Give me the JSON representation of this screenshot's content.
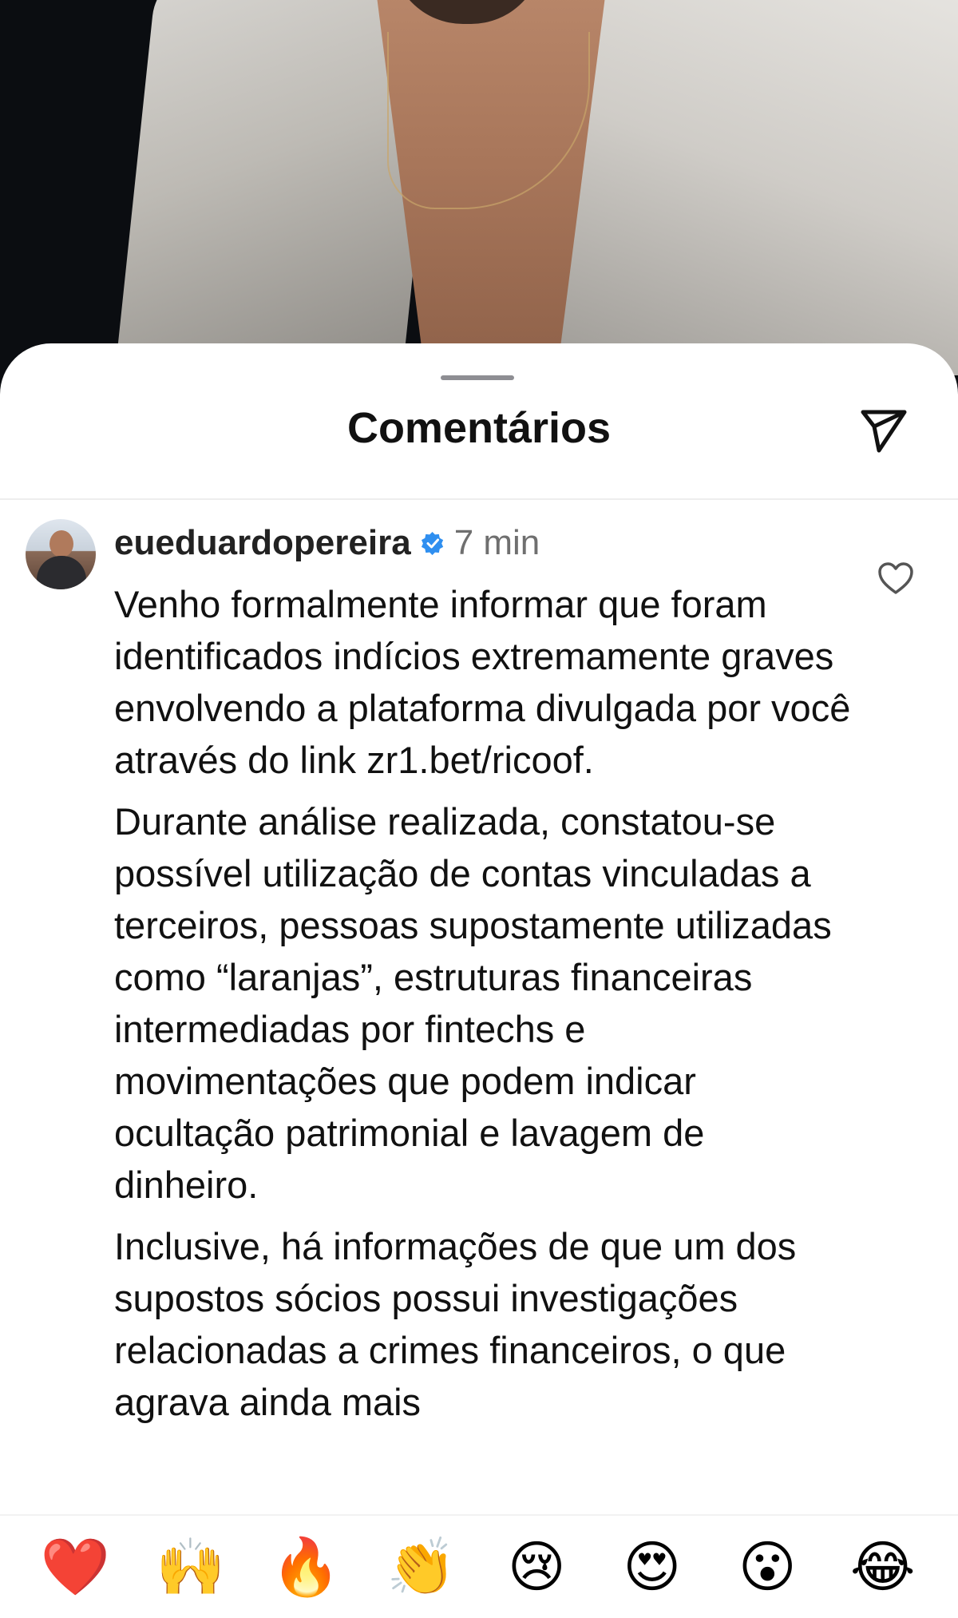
{
  "sheet": {
    "title": "Comentários"
  },
  "icons": {
    "share": "paper-plane-icon",
    "like": "heart-outline-icon",
    "verified": "verified-badge-icon"
  },
  "colors": {
    "verified_blue": "#2f8ff0",
    "text": "#111111",
    "muted": "#6f6f6f"
  },
  "comment": {
    "username": "eueduardopereira",
    "time": "7 min",
    "paragraphs": [
      "Venho formalmente informar que foram identificados indícios extremamente graves envolvendo a plataforma divulgada por você através do link zr1.bet/ricoof.",
      "Durante análise realizada, constatou-se possível utilização de contas vinculadas a terceiros, pessoas supostamente utilizadas como “laranjas”, estruturas financeiras intermediadas por fintechs e movimentações que podem indicar ocultação patrimonial e lavagem de dinheiro.",
      "Inclusive, há informações de que um dos supostos sócios possui investigações relacionadas a crimes financeiros, o que agrava ainda mais"
    ]
  },
  "reactions": [
    "❤️",
    "🙌",
    "🔥",
    "👏",
    "😢",
    "😍",
    "😮",
    "😂"
  ]
}
